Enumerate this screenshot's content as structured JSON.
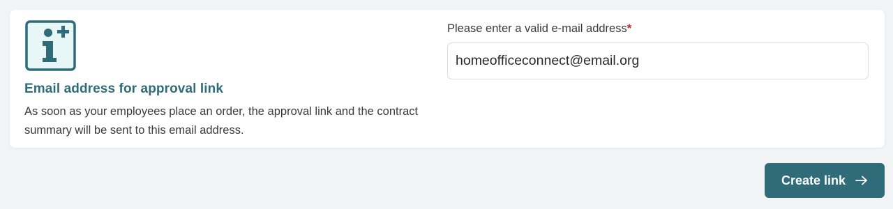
{
  "info": {
    "icon": "info-plus-icon",
    "title": "Email address for approval link",
    "description": "As soon as your employees place an order, the approval link and the contract summary will be sent to this email address."
  },
  "email_field": {
    "label": "Please enter a valid e-mail address",
    "required_marker": "*",
    "value": "homeofficeconnect@email.org"
  },
  "actions": {
    "create_label": "Create link",
    "create_icon": "arrow-right-icon"
  },
  "colors": {
    "accent": "#2f6b78",
    "icon_fill": "#e7f7f8",
    "required": "#c62828",
    "background": "#f2f3f5"
  }
}
